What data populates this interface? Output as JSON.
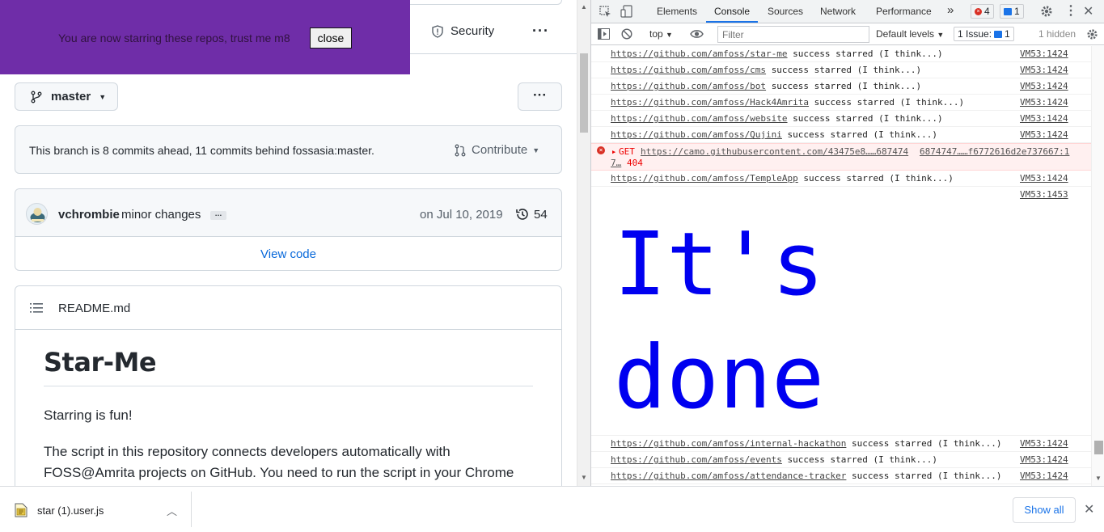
{
  "banner": {
    "message": "You are now starring these repos, trust me m8",
    "close_label": "close"
  },
  "repo_nav": {
    "security_label": "Security",
    "more_label": "···"
  },
  "branch": {
    "name": "master",
    "more_label": "···"
  },
  "ahead_behind": {
    "text": "This branch is 8 commits ahead, 11 commits behind fossasia:master.",
    "contribute_label": "Contribute"
  },
  "commit": {
    "author": "vchrombie",
    "message": "minor changes",
    "ellipsis": "…",
    "date": "on Jul 10, 2019",
    "count": "54",
    "view_code": "View code"
  },
  "readme": {
    "filename": "README.md",
    "title": "Star-Me",
    "p1": "Starring is fun!",
    "p2": "The script in this repository connects developers automatically with FOSS@Amrita projects on GitHub. You need to run the script in your Chrome"
  },
  "devtools": {
    "tabs": [
      "Elements",
      "Console",
      "Sources",
      "Network",
      "Performance"
    ],
    "more_tabs": "»",
    "error_count": "4",
    "message_count": "1",
    "context": "top",
    "filter_placeholder": "Filter",
    "levels": "Default levels",
    "issues": "1 Issue:",
    "issues_count": "1",
    "hidden": "1 hidden",
    "logs_top": [
      {
        "url": "https://github.com/amfoss/star-me",
        "msg": "success starred (I think...)",
        "src": "VM53:1424"
      },
      {
        "url": "https://github.com/amfoss/cms",
        "msg": "success starred (I think...)",
        "src": "VM53:1424"
      },
      {
        "url": "https://github.com/amfoss/bot",
        "msg": "success starred (I think...)",
        "src": "VM53:1424"
      },
      {
        "url": "https://github.com/amfoss/Hack4Amrita",
        "msg": "success starred (I think...)",
        "src": "VM53:1424"
      },
      {
        "url": "https://github.com/amfoss/website",
        "msg": "success starred (I think...)",
        "src": "VM53:1424"
      },
      {
        "url": "https://github.com/amfoss/Qujini",
        "msg": "success starred (I think...)",
        "src": "VM53:1424"
      }
    ],
    "error": {
      "method": "GET",
      "url": "https://camo.githubusercontent.com/43475e8……687474",
      "url2": "6874747……f6772616d2e737667:1",
      "line2": "7…",
      "status": "404"
    },
    "log_temple": {
      "url": "https://github.com/amfoss/TempleApp",
      "msg": "success starred (I think...)",
      "src": "VM53:1424"
    },
    "log_big_src": "VM53:1453",
    "big_line1": "It's",
    "big_line2": "done",
    "logs_bottom": [
      {
        "url": "https://github.com/amfoss/internal-hackathon",
        "msg": "success starred (I think...)",
        "src": "VM53:1424"
      },
      {
        "url": "https://github.com/amfoss/events",
        "msg": "success starred (I think...)",
        "src": "VM53:1424"
      },
      {
        "url": "https://github.com/amfoss/attendance-tracker",
        "msg": "success starred (I think...)",
        "src": "VM53:1424"
      }
    ]
  },
  "downloads": {
    "filename": "star (1).user.js",
    "show_all": "Show all"
  }
}
